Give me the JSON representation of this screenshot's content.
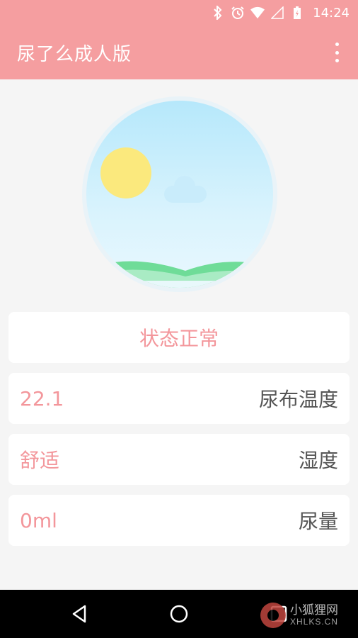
{
  "status_bar": {
    "time": "14:24",
    "icons": [
      "bluetooth-icon",
      "alarm-icon",
      "wifi-icon",
      "signal-icon",
      "battery-charging-icon"
    ]
  },
  "app_bar": {
    "title": "尿了么成人版",
    "menu_icon": "overflow-menu-icon"
  },
  "status_card": {
    "text": "状态正常"
  },
  "rows": [
    {
      "value": "22.1",
      "label": "尿布温度"
    },
    {
      "value": "舒适",
      "label": "湿度"
    },
    {
      "value": "0ml",
      "label": "尿量"
    }
  ],
  "nav_bar": {
    "icons": [
      "back-icon",
      "home-icon",
      "recents-icon"
    ]
  },
  "watermark": {
    "cn": "小狐狸网",
    "en": "XHLKS.CN"
  },
  "colors": {
    "primary": "#f59ea0",
    "accent_text": "#f3969b",
    "label_text": "#555555",
    "background": "#f5f5f5"
  }
}
